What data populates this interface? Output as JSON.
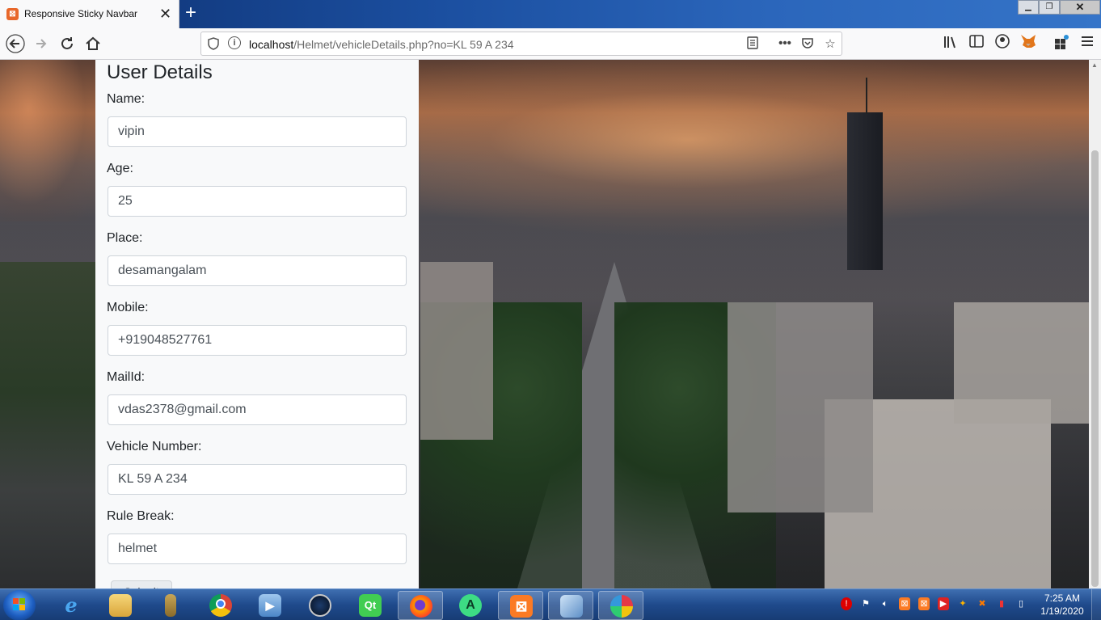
{
  "browser": {
    "tab_title": "Responsive Sticky Navbar",
    "favicon_letter": "⊠",
    "new_tab_label": "+",
    "url_host": "localhost",
    "url_path": "/Helmet/vehicleDetails.php?no=KL 59 A 234",
    "window_controls": {
      "minimize": "▁",
      "maximize": "❐",
      "close": "✕"
    },
    "nav_icons": [
      "back-icon",
      "forward-icon",
      "reload-icon",
      "home-icon"
    ],
    "url_actions": [
      "reader-view-icon",
      "more-actions-icon",
      "pocket-icon",
      "bookmark-star-icon"
    ],
    "toolbar_icons": [
      "library-icon",
      "sidebar-icon",
      "account-icon",
      "metamask-fox-icon",
      "extensions-icon",
      "menu-icon"
    ]
  },
  "page": {
    "heading": "User Details",
    "fields": [
      {
        "label": "Name:",
        "value": "vipin"
      },
      {
        "label": "Age:",
        "value": "25"
      },
      {
        "label": "Place:",
        "value": "desamangalam"
      },
      {
        "label": "Mobile:",
        "value": "+919048527761"
      },
      {
        "label": "MailId:",
        "value": "vdas2378@gmail.com"
      },
      {
        "label": "Vehicle Number:",
        "value": "KL 59 A 234"
      },
      {
        "label": "Rule Break:",
        "value": "helmet"
      }
    ],
    "submit_label": "Submit"
  },
  "taskbar": {
    "apps": [
      "internet-explorer-icon",
      "file-explorer-icon",
      "microscope-app-icon",
      "chrome-icon",
      "media-player-icon",
      "media-center-icon",
      "qt-creator-icon",
      "firefox-icon",
      "android-studio-icon",
      "xampp-icon",
      "virtualbox-icon",
      "paint-icon"
    ],
    "clock_time": "7:25 AM",
    "clock_date": "1/19/2020"
  }
}
